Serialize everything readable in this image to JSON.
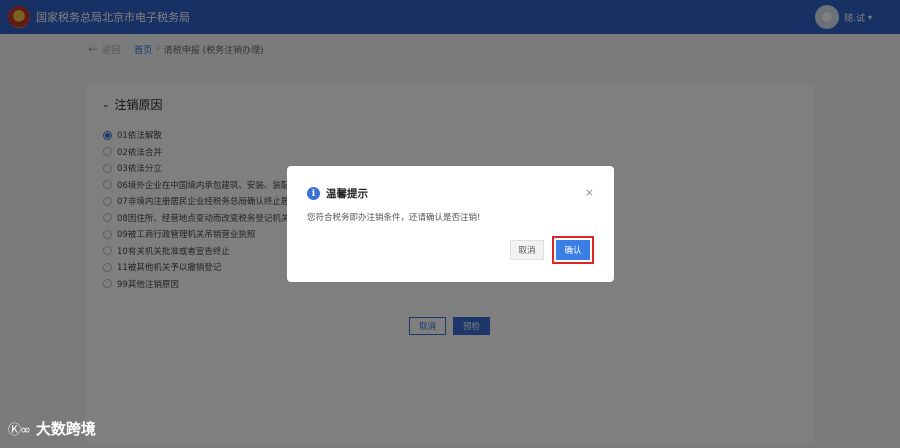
{
  "header": {
    "site_title": "国家税务总局北京市电子税务局",
    "user_name": "随.试"
  },
  "breadcrumb": {
    "back_label": "返回",
    "home": "首页",
    "separator": "›",
    "current": "清税申报 (税务注销办理)"
  },
  "section": {
    "title": "注销原因",
    "reasons": [
      {
        "label": "01依法解散",
        "selected": true
      },
      {
        "label": "02依法合并",
        "selected": false
      },
      {
        "label": "03依法分立",
        "selected": false
      },
      {
        "label": "06境外企业在中国境内承包建筑、安装、装配",
        "selected": false
      },
      {
        "label": "07非境内注册居民企业经税务总局确认终止居",
        "selected": false
      },
      {
        "label": "08因住所、经营地点变动而改变税务登记机关",
        "selected": false
      },
      {
        "label": "09被工商行政管理机关吊销营业执照",
        "selected": false
      },
      {
        "label": "10有关机关批准或者宣告终止",
        "selected": false
      },
      {
        "label": "11被其他机关予以撤销登记",
        "selected": false
      },
      {
        "label": "99其他注销原因",
        "selected": false
      }
    ],
    "cancel_label": "取消",
    "submit_label": "预检"
  },
  "dialog": {
    "title": "温馨提示",
    "message": "您符合税务即办注销条件，还请确认是否注销!",
    "cancel_label": "取消",
    "confirm_label": "确认",
    "close_symbol": "×",
    "info_symbol": "i"
  },
  "watermark": {
    "logo": "Ⓚ∞",
    "text": "大数跨境"
  },
  "colors": {
    "topbar": "#2e62c9",
    "accent": "#3a6fd4",
    "highlight": "#e02424"
  },
  "icons": [
    "tax-emblem-icon",
    "avatar-icon",
    "back-arrow-icon",
    "chevron-down-icon",
    "info-icon",
    "close-icon"
  ]
}
